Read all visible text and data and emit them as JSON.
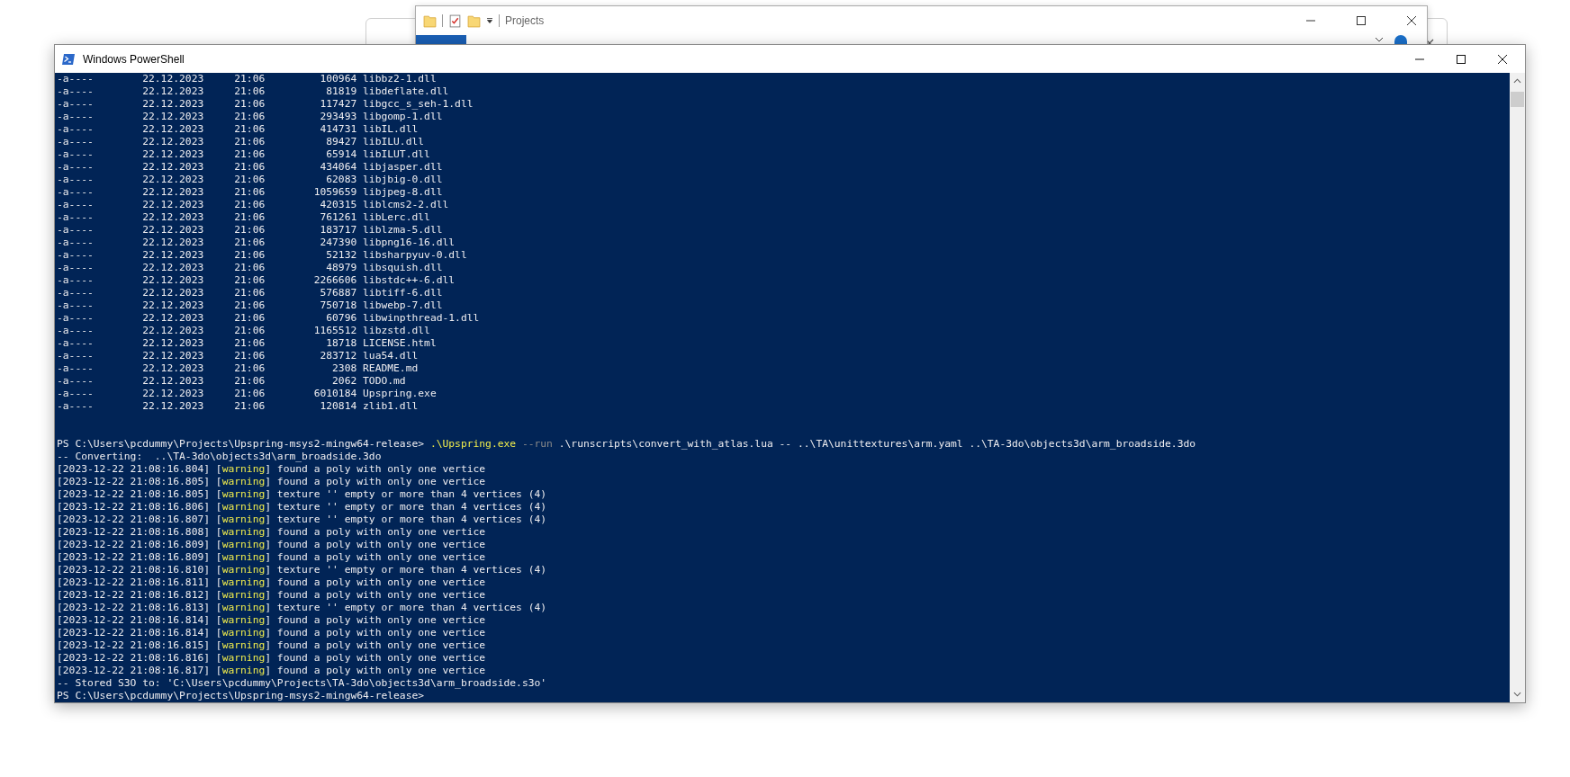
{
  "explorer": {
    "title": "Projects"
  },
  "powershell": {
    "title": "Windows PowerShell",
    "lines": [
      {
        "kind": "plain",
        "text": "-a----        22.12.2023     21:06         100964 libbz2-1.dll"
      },
      {
        "kind": "plain",
        "text": "-a----        22.12.2023     21:06          81819 libdeflate.dll"
      },
      {
        "kind": "plain",
        "text": "-a----        22.12.2023     21:06         117427 libgcc_s_seh-1.dll"
      },
      {
        "kind": "plain",
        "text": "-a----        22.12.2023     21:06         293493 libgomp-1.dll"
      },
      {
        "kind": "plain",
        "text": "-a----        22.12.2023     21:06         414731 libIL.dll"
      },
      {
        "kind": "plain",
        "text": "-a----        22.12.2023     21:06          89427 libILU.dll"
      },
      {
        "kind": "plain",
        "text": "-a----        22.12.2023     21:06          65914 libILUT.dll"
      },
      {
        "kind": "plain",
        "text": "-a----        22.12.2023     21:06         434064 libjasper.dll"
      },
      {
        "kind": "plain",
        "text": "-a----        22.12.2023     21:06          62083 libjbig-0.dll"
      },
      {
        "kind": "plain",
        "text": "-a----        22.12.2023     21:06        1059659 libjpeg-8.dll"
      },
      {
        "kind": "plain",
        "text": "-a----        22.12.2023     21:06         420315 liblcms2-2.dll"
      },
      {
        "kind": "plain",
        "text": "-a----        22.12.2023     21:06         761261 libLerc.dll"
      },
      {
        "kind": "plain",
        "text": "-a----        22.12.2023     21:06         183717 liblzma-5.dll"
      },
      {
        "kind": "plain",
        "text": "-a----        22.12.2023     21:06         247390 libpng16-16.dll"
      },
      {
        "kind": "plain",
        "text": "-a----        22.12.2023     21:06          52132 libsharpyuv-0.dll"
      },
      {
        "kind": "plain",
        "text": "-a----        22.12.2023     21:06          48979 libsquish.dll"
      },
      {
        "kind": "plain",
        "text": "-a----        22.12.2023     21:06        2266606 libstdc++-6.dll"
      },
      {
        "kind": "plain",
        "text": "-a----        22.12.2023     21:06         576887 libtiff-6.dll"
      },
      {
        "kind": "plain",
        "text": "-a----        22.12.2023     21:06         750718 libwebp-7.dll"
      },
      {
        "kind": "plain",
        "text": "-a----        22.12.2023     21:06          60796 libwinpthread-1.dll"
      },
      {
        "kind": "plain",
        "text": "-a----        22.12.2023     21:06        1165512 libzstd.dll"
      },
      {
        "kind": "plain",
        "text": "-a----        22.12.2023     21:06          18718 LICENSE.html"
      },
      {
        "kind": "plain",
        "text": "-a----        22.12.2023     21:06         283712 lua54.dll"
      },
      {
        "kind": "plain",
        "text": "-a----        22.12.2023     21:06           2308 README.md"
      },
      {
        "kind": "plain",
        "text": "-a----        22.12.2023     21:06           2062 TODO.md"
      },
      {
        "kind": "plain",
        "text": "-a----        22.12.2023     21:06        6010184 Upspring.exe"
      },
      {
        "kind": "plain",
        "text": "-a----        22.12.2023     21:06         120814 zlib1.dll"
      },
      {
        "kind": "blank"
      },
      {
        "kind": "blank"
      },
      {
        "kind": "colored",
        "segments": [
          {
            "text": "PS C:\\Users\\pcdummy\\Projects\\Upspring-msys2-mingw64-release> ",
            "kind": "plain"
          },
          {
            "text": ".\\Upspring.exe",
            "kind": "command"
          },
          {
            "text": " --run",
            "kind": "parameter"
          },
          {
            "text": " .\\runscripts\\convert_with_atlas.lua -- ..\\TA\\unittextures\\arm.yaml ..\\TA-3do\\objects3d\\arm_broadside.3do",
            "kind": "plain"
          }
        ]
      },
      {
        "kind": "plain",
        "text": "-- Converting:  ..\\TA-3do\\objects3d\\arm_broadside.3do"
      },
      {
        "kind": "colored",
        "segments": [
          {
            "text": "[2023-12-22 21:08:16.804] [",
            "kind": "plain"
          },
          {
            "text": "warning",
            "kind": "command"
          },
          {
            "text": "] found a poly with only one vertice",
            "kind": "plain"
          }
        ]
      },
      {
        "kind": "colored",
        "segments": [
          {
            "text": "[2023-12-22 21:08:16.805] [",
            "kind": "plain"
          },
          {
            "text": "warning",
            "kind": "command"
          },
          {
            "text": "] found a poly with only one vertice",
            "kind": "plain"
          }
        ]
      },
      {
        "kind": "colored",
        "segments": [
          {
            "text": "[2023-12-22 21:08:16.805] [",
            "kind": "plain"
          },
          {
            "text": "warning",
            "kind": "command"
          },
          {
            "text": "] texture '' empty or more than 4 vertices (4)",
            "kind": "plain"
          }
        ]
      },
      {
        "kind": "colored",
        "segments": [
          {
            "text": "[2023-12-22 21:08:16.806] [",
            "kind": "plain"
          },
          {
            "text": "warning",
            "kind": "command"
          },
          {
            "text": "] texture '' empty or more than 4 vertices (4)",
            "kind": "plain"
          }
        ]
      },
      {
        "kind": "colored",
        "segments": [
          {
            "text": "[2023-12-22 21:08:16.807] [",
            "kind": "plain"
          },
          {
            "text": "warning",
            "kind": "command"
          },
          {
            "text": "] texture '' empty or more than 4 vertices (4)",
            "kind": "plain"
          }
        ]
      },
      {
        "kind": "colored",
        "segments": [
          {
            "text": "[2023-12-22 21:08:16.808] [",
            "kind": "plain"
          },
          {
            "text": "warning",
            "kind": "command"
          },
          {
            "text": "] found a poly with only one vertice",
            "kind": "plain"
          }
        ]
      },
      {
        "kind": "colored",
        "segments": [
          {
            "text": "[2023-12-22 21:08:16.809] [",
            "kind": "plain"
          },
          {
            "text": "warning",
            "kind": "command"
          },
          {
            "text": "] found a poly with only one vertice",
            "kind": "plain"
          }
        ]
      },
      {
        "kind": "colored",
        "segments": [
          {
            "text": "[2023-12-22 21:08:16.809] [",
            "kind": "plain"
          },
          {
            "text": "warning",
            "kind": "command"
          },
          {
            "text": "] found a poly with only one vertice",
            "kind": "plain"
          }
        ]
      },
      {
        "kind": "colored",
        "segments": [
          {
            "text": "[2023-12-22 21:08:16.810] [",
            "kind": "plain"
          },
          {
            "text": "warning",
            "kind": "command"
          },
          {
            "text": "] texture '' empty or more than 4 vertices (4)",
            "kind": "plain"
          }
        ]
      },
      {
        "kind": "colored",
        "segments": [
          {
            "text": "[2023-12-22 21:08:16.811] [",
            "kind": "plain"
          },
          {
            "text": "warning",
            "kind": "command"
          },
          {
            "text": "] found a poly with only one vertice",
            "kind": "plain"
          }
        ]
      },
      {
        "kind": "colored",
        "segments": [
          {
            "text": "[2023-12-22 21:08:16.812] [",
            "kind": "plain"
          },
          {
            "text": "warning",
            "kind": "command"
          },
          {
            "text": "] found a poly with only one vertice",
            "kind": "plain"
          }
        ]
      },
      {
        "kind": "colored",
        "segments": [
          {
            "text": "[2023-12-22 21:08:16.813] [",
            "kind": "plain"
          },
          {
            "text": "warning",
            "kind": "command"
          },
          {
            "text": "] texture '' empty or more than 4 vertices (4)",
            "kind": "plain"
          }
        ]
      },
      {
        "kind": "colored",
        "segments": [
          {
            "text": "[2023-12-22 21:08:16.814] [",
            "kind": "plain"
          },
          {
            "text": "warning",
            "kind": "command"
          },
          {
            "text": "] found a poly with only one vertice",
            "kind": "plain"
          }
        ]
      },
      {
        "kind": "colored",
        "segments": [
          {
            "text": "[2023-12-22 21:08:16.814] [",
            "kind": "plain"
          },
          {
            "text": "warning",
            "kind": "command"
          },
          {
            "text": "] found a poly with only one vertice",
            "kind": "plain"
          }
        ]
      },
      {
        "kind": "colored",
        "segments": [
          {
            "text": "[2023-12-22 21:08:16.815] [",
            "kind": "plain"
          },
          {
            "text": "warning",
            "kind": "command"
          },
          {
            "text": "] found a poly with only one vertice",
            "kind": "plain"
          }
        ]
      },
      {
        "kind": "colored",
        "segments": [
          {
            "text": "[2023-12-22 21:08:16.816] [",
            "kind": "plain"
          },
          {
            "text": "warning",
            "kind": "command"
          },
          {
            "text": "] found a poly with only one vertice",
            "kind": "plain"
          }
        ]
      },
      {
        "kind": "colored",
        "segments": [
          {
            "text": "[2023-12-22 21:08:16.817] [",
            "kind": "plain"
          },
          {
            "text": "warning",
            "kind": "command"
          },
          {
            "text": "] found a poly with only one vertice",
            "kind": "plain"
          }
        ]
      },
      {
        "kind": "plain",
        "text": "-- Stored S3O to: 'C:\\Users\\pcdummy\\Projects\\TA-3do\\objects3d\\arm_broadside.s3o'"
      },
      {
        "kind": "plain",
        "text": "PS C:\\Users\\pcdummy\\Projects\\Upspring-msys2-mingw64-release>"
      }
    ]
  }
}
